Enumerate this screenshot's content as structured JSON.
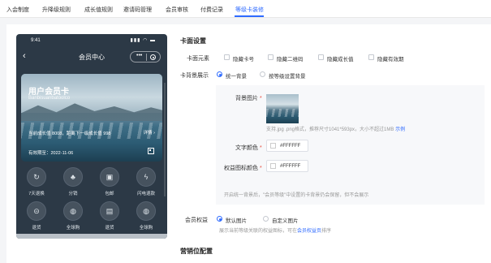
{
  "tabs": [
    {
      "label": "入会制度"
    },
    {
      "label": "升降级规则"
    },
    {
      "label": "成长值规则"
    },
    {
      "label": "邀请码管理"
    },
    {
      "label": "会员审核"
    },
    {
      "label": "付费记录"
    },
    {
      "label": "等级卡装修"
    }
  ],
  "active_tab": "等级卡装修",
  "accent_color": "#2f6bff",
  "phone": {
    "time": "9:41",
    "signal": "▮▮▮ ◠ ▬",
    "title": "会员中心",
    "back_icon": "‹",
    "capsule_dots": "•••",
    "card": {
      "name": "用户会员卡",
      "number": "Banbisuanbatoolco",
      "growth": "当前成长值 8008，距离下一级成长值 998",
      "detail": "详情 ›",
      "valid": "有效期至：2022-11-06"
    },
    "benefits": [
      {
        "label": "7天退换",
        "icon": "↻"
      },
      {
        "label": "分销",
        "icon": "♣"
      },
      {
        "label": "包邮",
        "icon": "▣"
      },
      {
        "label": "闪电退款",
        "icon": "ϟ"
      },
      {
        "label": "退货",
        "icon": "⊝"
      },
      {
        "label": "全球购",
        "icon": "◍"
      },
      {
        "label": "退货",
        "icon": "▤"
      },
      {
        "label": "全球购",
        "icon": "◍"
      }
    ]
  },
  "settings": {
    "card_section_title": "卡面设置",
    "elements_label": "卡面元素",
    "element_options": [
      {
        "label": "隐藏卡号"
      },
      {
        "label": "隐藏二维码"
      },
      {
        "label": "隐藏成长值"
      },
      {
        "label": "隐藏有效期"
      }
    ],
    "bg_label": "卡背景展示",
    "bg_options": [
      {
        "label": "统一背景",
        "selected": true
      },
      {
        "label": "按等级设置背景",
        "selected": false
      }
    ],
    "bg_image_label": "背景图片",
    "bg_image_hint": "支持.jpg .png格式，推荐尺寸1041*593px，大小不超过1MB",
    "bg_image_example": "示例",
    "text_color_label": "文字颜色",
    "text_color_value": "#FFFFFF",
    "icon_color_label": "权益图标颜色",
    "icon_color_value": "#FFFFFF",
    "bg_note": "开启统一背景后，\"会员等级\"中设置的卡背景仍会保留，但不会展示",
    "benefits_label": "会员权益",
    "benefits_options": [
      {
        "label": "默认图片",
        "selected": true
      },
      {
        "label": "自定义图片",
        "selected": false
      }
    ],
    "benefits_hint_prefix": "展示当前等级关联的权益图标，可在",
    "benefits_hint_link": "会员权益页",
    "benefits_hint_suffix": "排序",
    "marketing_section_title": "营销位配置"
  }
}
